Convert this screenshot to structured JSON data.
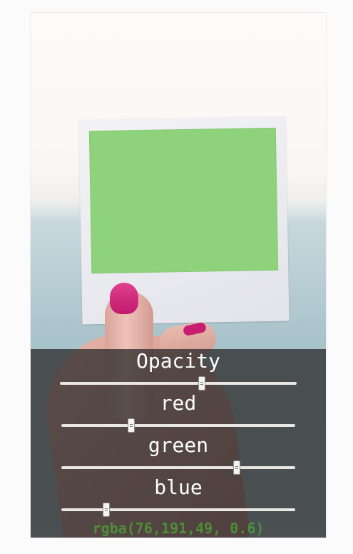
{
  "controls": {
    "opacity": {
      "label": "Opacity",
      "value": 0.6,
      "min": 0,
      "max": 1
    },
    "red": {
      "label": "red",
      "value": 76,
      "min": 0,
      "max": 255
    },
    "green": {
      "label": "green",
      "value": 191,
      "min": 0,
      "max": 255
    },
    "blue": {
      "label": "blue",
      "value": 49,
      "min": 0,
      "max": 255
    }
  },
  "readout": "rgba(76,191,49, 0.6)",
  "colors": {
    "swatch": "#8fd27c",
    "readout_text": "#4cbf31",
    "panel": "#282828",
    "track": "#e9e7e2"
  }
}
